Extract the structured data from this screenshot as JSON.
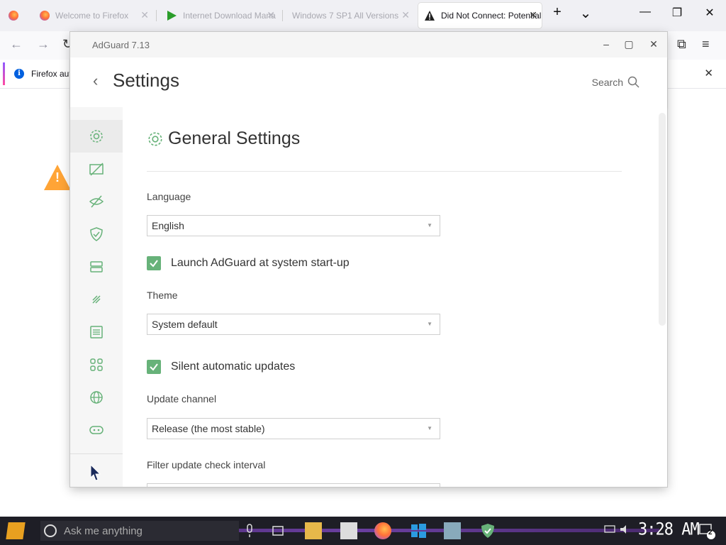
{
  "browser": {
    "tabs": [
      {
        "title": "",
        "active": false
      },
      {
        "title": "Welcome to Firefox",
        "active": false
      },
      {
        "title": "Internet Download Mana",
        "active": false
      },
      {
        "title": "Windows 7 SP1 All Versions",
        "active": false
      },
      {
        "title": "Did Not Connect: Potential",
        "active": true
      }
    ],
    "new_tab_glyph": "+",
    "tab_list_glyph": "⌄",
    "notification": "Firefox autom"
  },
  "adguard": {
    "window_title": "AdGuard 7.13",
    "header": {
      "back_glyph": "‹",
      "title": "Settings",
      "search_label": "Search"
    },
    "sidebar_icons": [
      "gear-icon",
      "ad-block-icon",
      "stealth-eye-icon",
      "shield-icon",
      "server-icon",
      "rocket-icon",
      "list-icon",
      "apps-grid-icon",
      "globe-icon",
      "gamepad-icon"
    ],
    "section_title": "General Settings",
    "language": {
      "label": "Language",
      "value": "English"
    },
    "launch_startup": {
      "label": "Launch AdGuard at system start-up",
      "checked": true
    },
    "theme": {
      "label": "Theme",
      "value": "System default"
    },
    "silent_updates": {
      "label": "Silent automatic updates",
      "checked": true
    },
    "update_channel": {
      "label": "Update channel",
      "value": "Release (the most stable)"
    },
    "filter_interval": {
      "label": "Filter update check interval"
    },
    "accent_color": "#67b279"
  },
  "taskbar": {
    "search_placeholder": "Ask me anything",
    "clock": "3:28 AM",
    "notification_count": "2"
  }
}
